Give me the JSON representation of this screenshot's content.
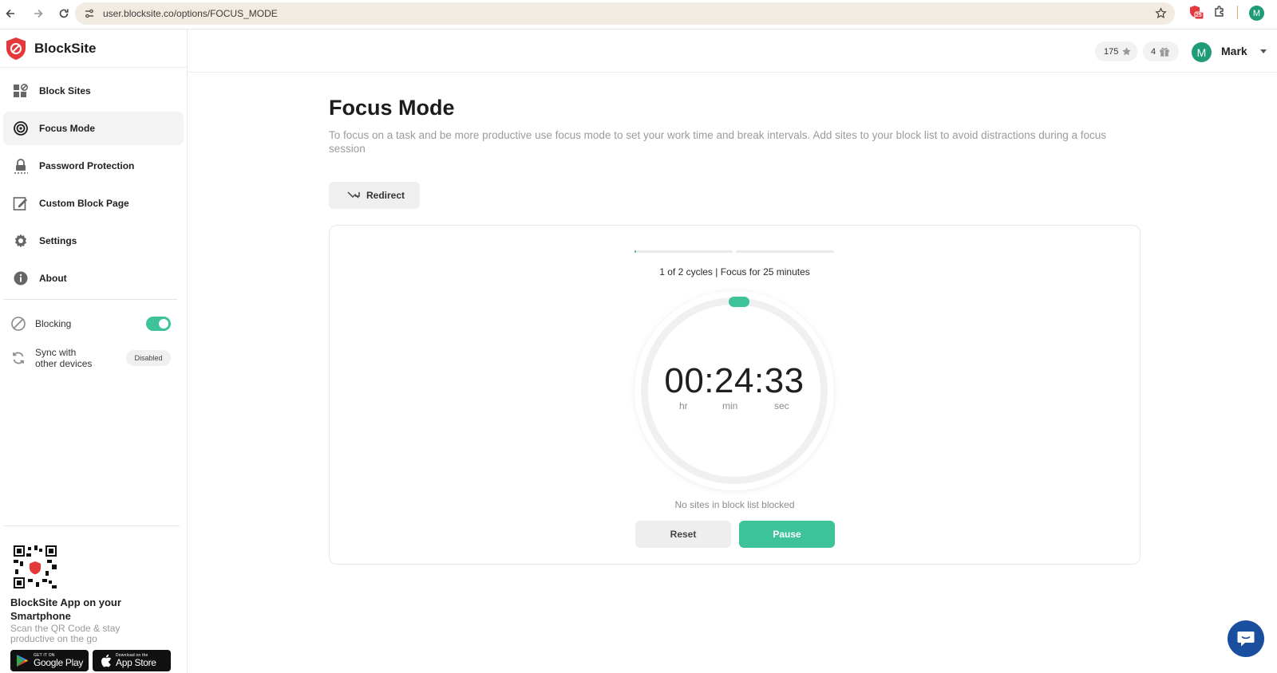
{
  "browser": {
    "url": "user.blocksite.co/options/FOCUS_MODE",
    "extension_badge": "25",
    "profile_initial": "M"
  },
  "brand": {
    "name": "BlockSite",
    "accent": "#e5383b"
  },
  "sidebar": {
    "items": [
      {
        "label": "Block Sites",
        "icon": "grid-block-icon"
      },
      {
        "label": "Focus Mode",
        "icon": "target-icon",
        "active": true
      },
      {
        "label": "Password Protection",
        "icon": "lock-icon"
      },
      {
        "label": "Custom Block Page",
        "icon": "edit-page-icon"
      },
      {
        "label": "Settings",
        "icon": "gear-icon"
      },
      {
        "label": "About",
        "icon": "info-icon"
      }
    ],
    "blocking": {
      "label": "Blocking",
      "on": true
    },
    "sync": {
      "label_line1": "Sync with",
      "label_line2": "other devices",
      "status": "Disabled"
    },
    "app_card": {
      "title": "BlockSite App on your Smartphone",
      "subtitle": "Scan the QR Code & stay productive on the go",
      "google_play_small": "GET IT ON",
      "google_play_big": "Google Play",
      "app_store_small": "Download on the",
      "app_store_big": "App Store"
    }
  },
  "header": {
    "points": "175",
    "gifts": "4",
    "user_initial": "M",
    "user_name": "Mark"
  },
  "main": {
    "title": "Focus Mode",
    "description": "To focus on a task and be more productive use focus mode to set your work time and break intervals. Add sites to your block list to avoid distractions during a focus session",
    "redirect_label": "Redirect"
  },
  "timer": {
    "cycle_text": "1 of 2 cycles | Focus for 25 minutes",
    "current_cycle": 1,
    "total_cycles": 2,
    "cycle_progress": 0.02,
    "time": "00:24:33",
    "units": {
      "hr": "hr",
      "min": "min",
      "sec": "sec"
    },
    "blocked_note": "No sites in block list blocked",
    "reset_label": "Reset",
    "pause_label": "Pause",
    "accent": "#3dc29a"
  }
}
